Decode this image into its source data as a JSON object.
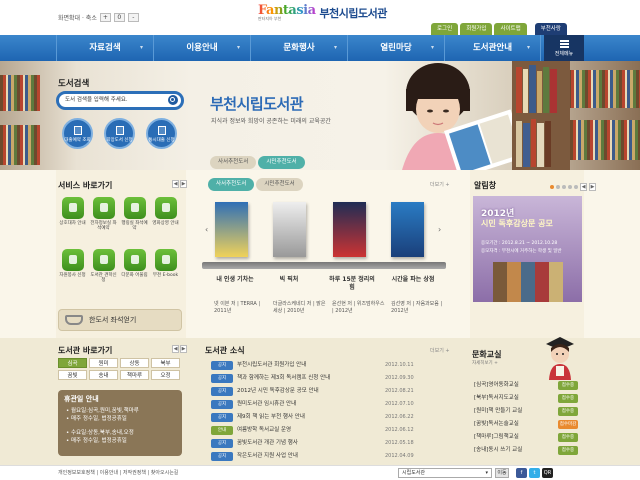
{
  "topbar": {
    "zoom_label": "화면확대 · 축소",
    "zoom_plus": "+",
    "zoom_reset": "0",
    "zoom_minus": "-",
    "logo_word": "Fantasia",
    "logo_sub": "판타지아 부천",
    "logo_name": "부천시립도서관",
    "util": [
      "로그인",
      "회원가입",
      "사이트맵"
    ],
    "util_site": "부천사랑"
  },
  "nav": {
    "items": [
      "자료검색",
      "이용안내",
      "문화행사",
      "열린마당",
      "도서관안내"
    ],
    "all_menu": "전체메뉴"
  },
  "search": {
    "title": "도서검색",
    "placeholder": "도서 검색을 입력해 주세요.",
    "buttons": [
      "대출예약 조회",
      "희망도서 신청",
      "통시대출 신청"
    ]
  },
  "hero": {
    "title": "부천시립도서관",
    "subtitle": "지식과 정보와 희망이 공존하는 미래의 교육공간",
    "tabs": [
      "사서추천도서",
      "시민추천도서"
    ]
  },
  "services": {
    "title": "서비스 바로가기",
    "items": [
      "상호대차 안내",
      "전자정보실 좌석예약",
      "행링실 좌석예약",
      "영화상영 안내",
      "자원봉사 신청",
      "도서관 견학신청",
      "다문화 어울림",
      "부천 E-book"
    ],
    "seat_label": "한도서 좌석얻기"
  },
  "recommend": {
    "tabs": [
      "사서추천도서",
      "시민추천도서"
    ],
    "more": "더보기 +",
    "books": [
      {
        "title": "내 인생 기차는",
        "meta": "넷 이븐 저 | TERRA | 2011년"
      },
      {
        "title": "빅 픽처",
        "meta": "더글라스케네디 저 | 밝은세상 | 2010년"
      },
      {
        "title": "하루 15분 정리의 힘",
        "meta": "윤선현 저 | 위즈덤하우스 | 2012년"
      },
      {
        "title": "시간을 파는 상점",
        "meta": "김선영 저 | 자음과모음 | 2012년"
      }
    ]
  },
  "notice": {
    "title": "알림창",
    "popup_t1": "2012년",
    "popup_t2": "시민 독후감상문 공모",
    "popup_l1": "응모기간 : 2012.8.21 ~ 2012.10.28",
    "popup_l2": "응모자격 : 부천시에 거주하는 학생 및 일반"
  },
  "libraries": {
    "title": "도서관 바로가기",
    "items": [
      "심곡",
      "원미",
      "상동",
      "북부",
      "꿈빛",
      "송내",
      "책마루",
      "오정"
    ],
    "closed_title": "휴관일 안내",
    "closed_lines": [
      "• 월요일:심곡,원미,꿈빛,책마루",
      "  • 매주 정수일, 법정공휴일",
      "• 수요일:상동,북부,송내,오정",
      "  • 매주 정수일, 법정공휴일"
    ]
  },
  "news": {
    "title": "도서관 소식",
    "more": "더보기 +",
    "rows": [
      {
        "badge": "공지",
        "text": "부천시립도서관 회원가입 안내",
        "date": "2012.10.11"
      },
      {
        "badge": "공지",
        "text": "책과 함께하는 제3회 독서캠프 신청 안내",
        "date": "2012.09.30"
      },
      {
        "badge": "공지",
        "text": "2012년 시민 독후감상문 공모 안내",
        "date": "2012.08.21"
      },
      {
        "badge": "공지",
        "text": "원미도서관 임시휴관 안내",
        "date": "2012.07.10"
      },
      {
        "badge": "공지",
        "text": "제9회 책 읽는 부천 행사 안내",
        "date": "2012.06.22"
      },
      {
        "badge": "안내",
        "text": "여름방학 독서교실 운영",
        "date": "2012.06.12"
      },
      {
        "badge": "공지",
        "text": "꿈빛도서관 개관 기념 행사",
        "date": "2012.05.18"
      },
      {
        "badge": "공지",
        "text": "작은도서관 지원 사업 안내",
        "date": "2012.04.09"
      }
    ]
  },
  "classes": {
    "title": "문화교실",
    "subtitle": "자세히보기 +",
    "rows": [
      {
        "text": "[심곡]영어동화교실",
        "tag": "접수중"
      },
      {
        "text": "[북부]독서지도교실",
        "tag": "접수중"
      },
      {
        "text": "[원미]책 만들기 교실",
        "tag": "접수중"
      },
      {
        "text": "[꿈빛]독서논술교실",
        "tag": "접수마감"
      },
      {
        "text": "[책마루]그림책교실",
        "tag": "접수중"
      },
      {
        "text": "[송내]동시 쓰기 교실",
        "tag": "접수중"
      }
    ]
  },
  "footer": {
    "links": "개인정보보호정책 | 이용안내 | 저작권정책 | 찾아오시는길",
    "select": "시립도서관",
    "go": "이동",
    "icons": [
      "f",
      "t",
      "QR"
    ]
  },
  "colors": {
    "nav_blue": "#2f79c2",
    "green": "#7fa63a",
    "teal_tab": "#4fb0a8",
    "title_blue": "#2d6bb6",
    "badge_blue": "#3a78bf",
    "badge_orange": "#e98a2f"
  }
}
